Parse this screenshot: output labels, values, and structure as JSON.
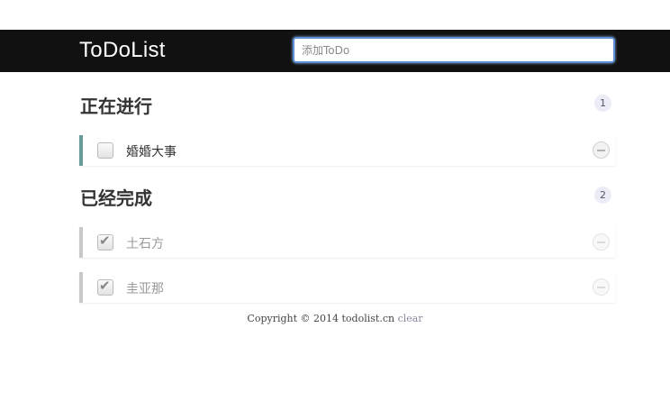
{
  "header": {
    "title": "ToDoList",
    "input_placeholder": "添加ToDo"
  },
  "sections": {
    "in_progress": {
      "title": "正在进行",
      "count": "1",
      "items": [
        {
          "text": "婚婚大事",
          "checked": false
        }
      ]
    },
    "completed": {
      "title": "已经完成",
      "count": "2",
      "items": [
        {
          "text": "土石方",
          "checked": true
        },
        {
          "text": "圭亚那",
          "checked": true
        }
      ]
    }
  },
  "footer": {
    "copyright": "Copyright © 2014 todolist.cn",
    "clear_label": "clear"
  },
  "colors": {
    "header_bg": "#111111",
    "active_border": "#6a9b9b",
    "done_border": "#c8c8c8",
    "input_focus": "#5b8fd6"
  },
  "icons": {
    "check": "check-icon",
    "delete": "minus-circle-icon"
  }
}
